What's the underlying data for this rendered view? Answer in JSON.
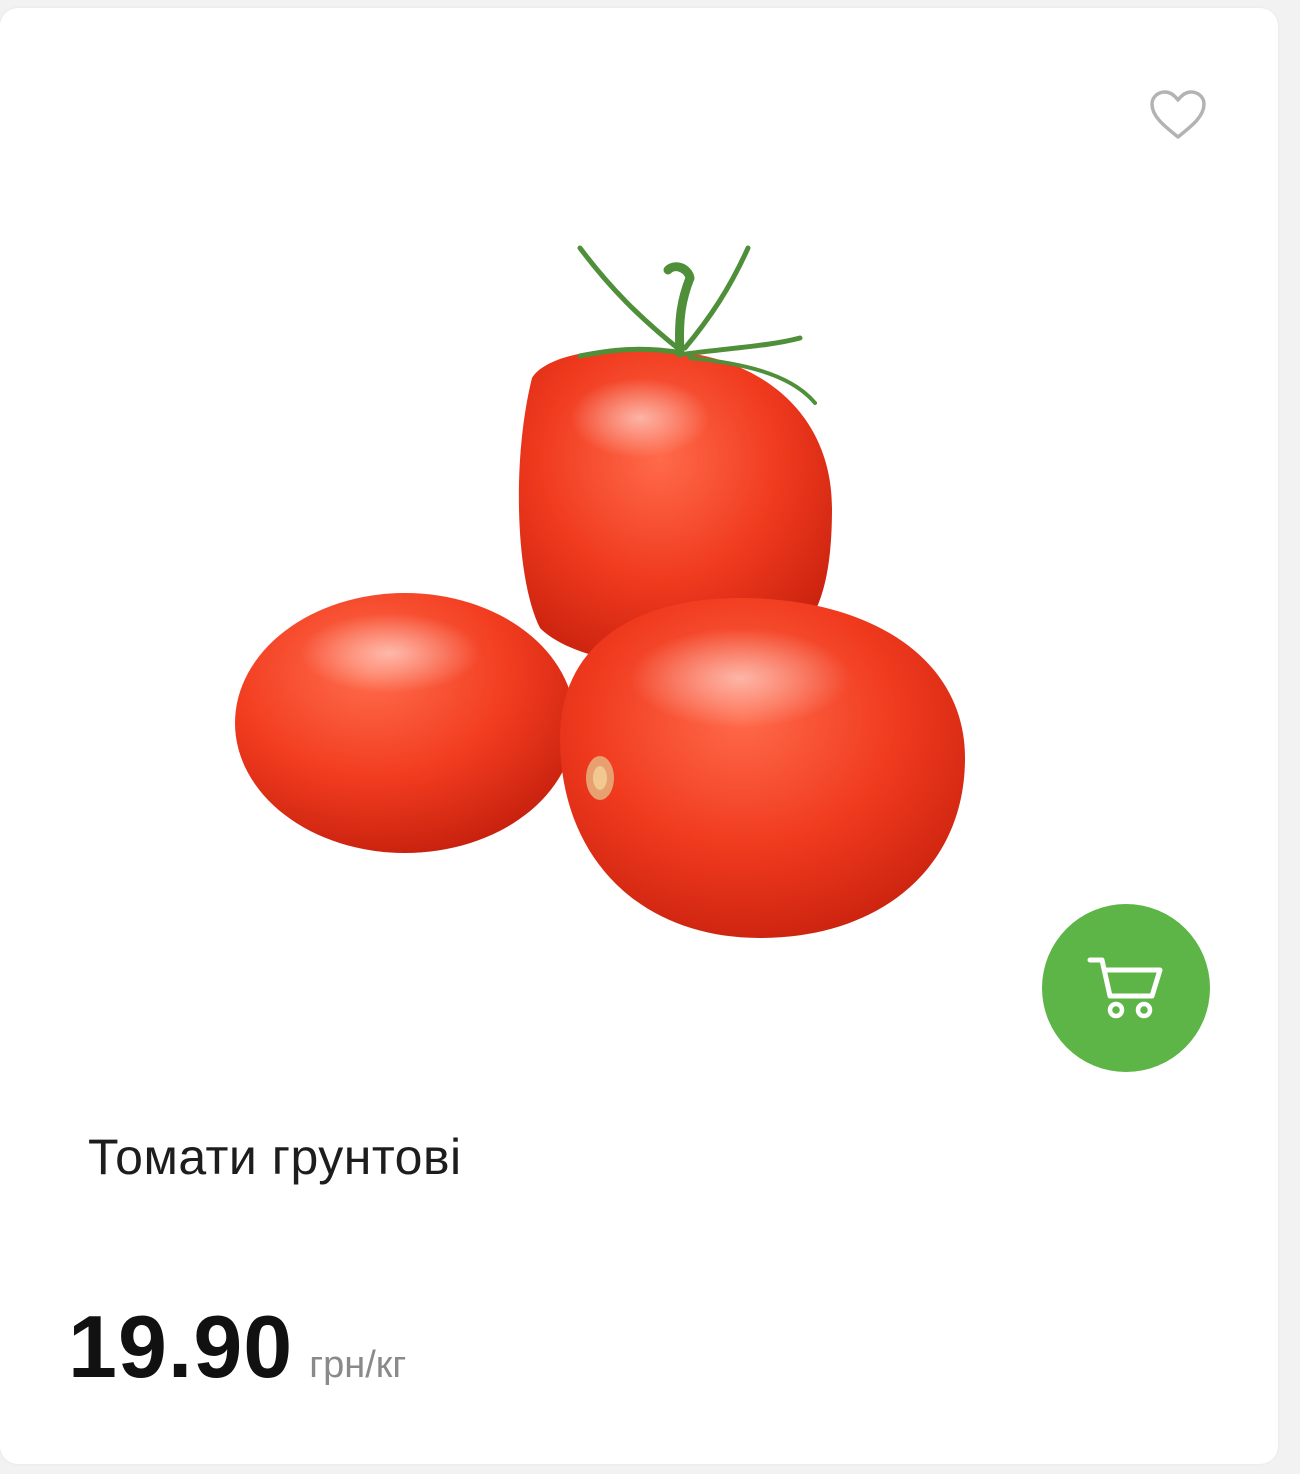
{
  "product": {
    "name": "Томати грунтові",
    "price": "19.90",
    "unit": "грн/кг"
  },
  "icons": {
    "favorite": "heart-outline-icon",
    "cart": "shopping-cart-icon"
  },
  "colors": {
    "accent": "#5cb546",
    "favorite_icon": "#b3b3b3",
    "price_unit": "#8a8a8a",
    "tomato": "#f03a1e"
  }
}
